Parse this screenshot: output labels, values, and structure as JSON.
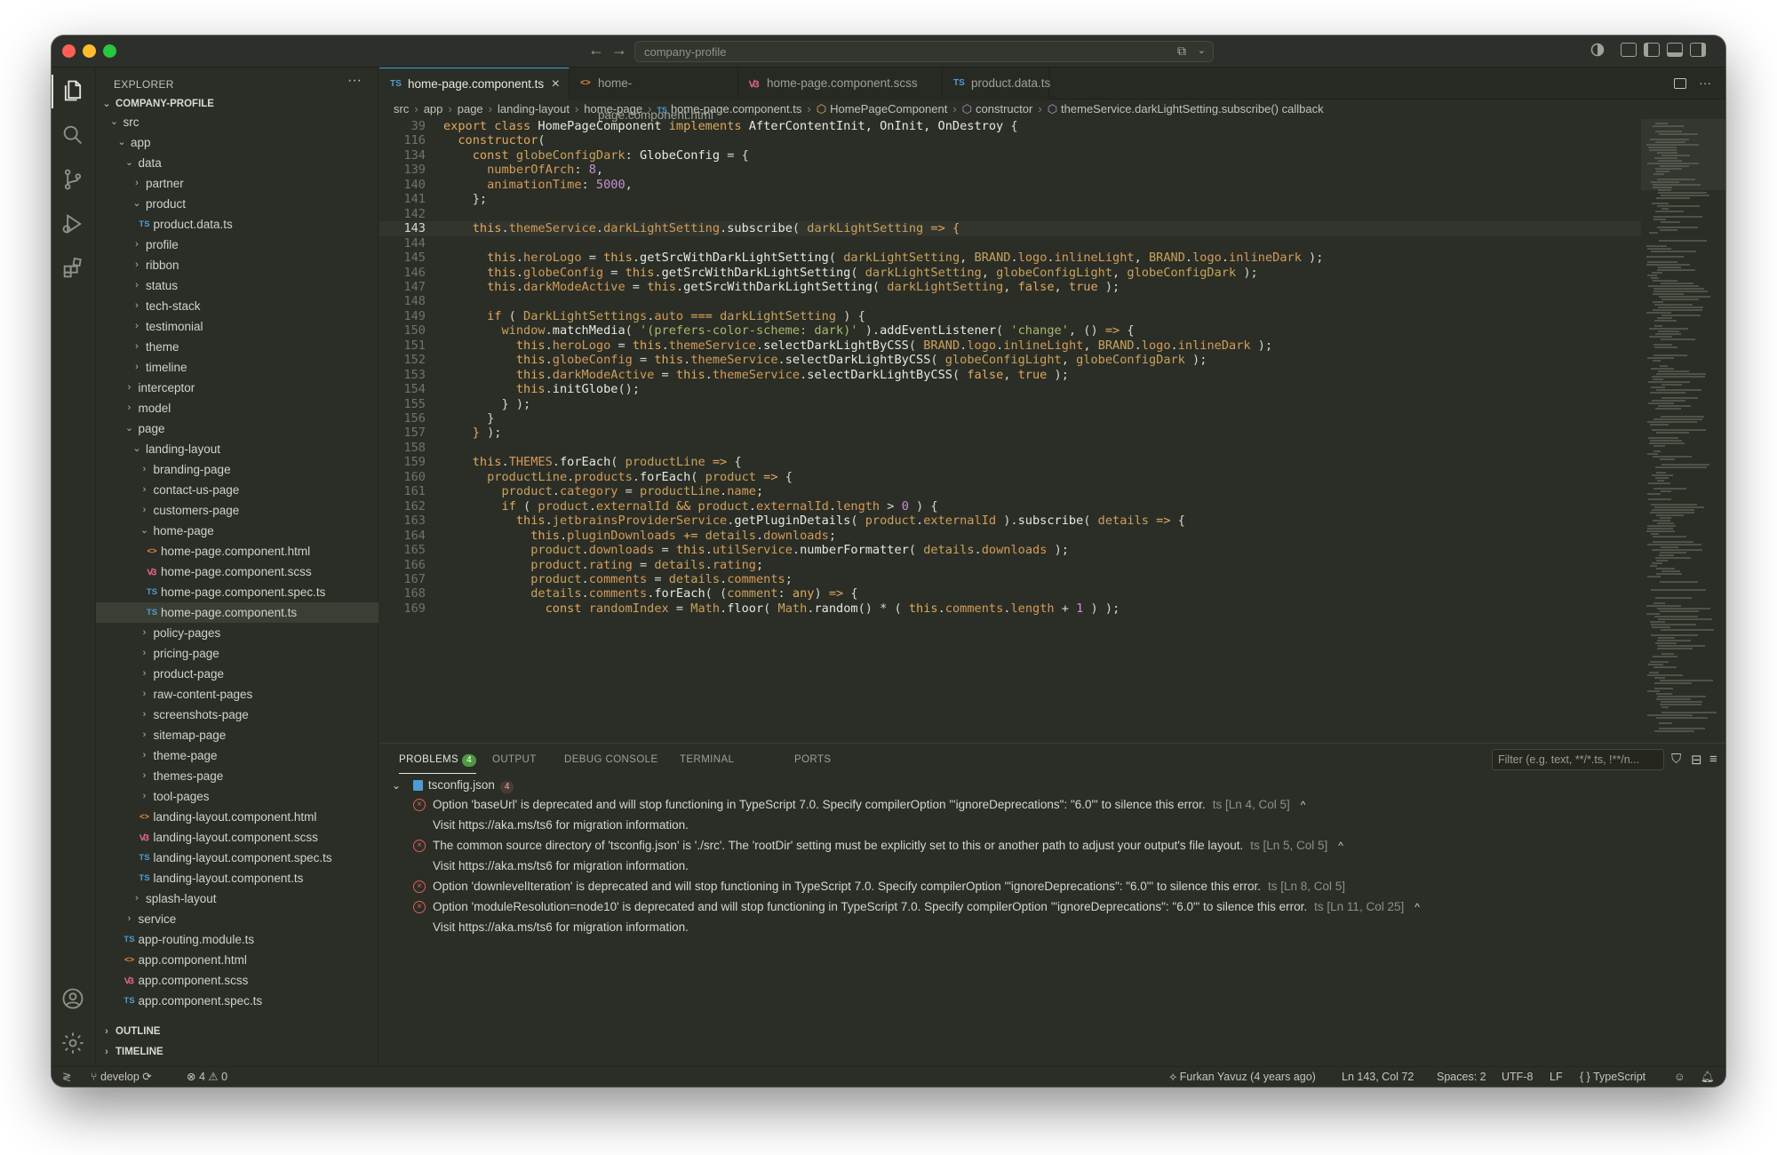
{
  "titlebar": {
    "search_text": "company-profile"
  },
  "sidebar": {
    "title": "EXPLORER",
    "more": "···",
    "root": "COMPANY-PROFILE",
    "outline": "OUTLINE",
    "timeline": "TIMELINE"
  },
  "tree": [
    {
      "label": "src",
      "depth": 1,
      "chev": "open"
    },
    {
      "label": "app",
      "depth": 2,
      "chev": "open"
    },
    {
      "label": "data",
      "depth": 3,
      "chev": "open"
    },
    {
      "label": "partner",
      "depth": 4,
      "chev": "closed"
    },
    {
      "label": "product",
      "depth": 4,
      "chev": "open"
    },
    {
      "label": "product.data.ts",
      "depth": 5,
      "icon": "TS"
    },
    {
      "label": "profile",
      "depth": 4,
      "chev": "closed"
    },
    {
      "label": "ribbon",
      "depth": 4,
      "chev": "closed"
    },
    {
      "label": "status",
      "depth": 4,
      "chev": "closed"
    },
    {
      "label": "tech-stack",
      "depth": 4,
      "chev": "closed"
    },
    {
      "label": "testimonial",
      "depth": 4,
      "chev": "closed"
    },
    {
      "label": "theme",
      "depth": 4,
      "chev": "closed"
    },
    {
      "label": "timeline",
      "depth": 4,
      "chev": "closed"
    },
    {
      "label": "interceptor",
      "depth": 3,
      "chev": "closed"
    },
    {
      "label": "model",
      "depth": 3,
      "chev": "closed"
    },
    {
      "label": "page",
      "depth": 3,
      "chev": "open"
    },
    {
      "label": "landing-layout",
      "depth": 4,
      "chev": "open"
    },
    {
      "label": "branding-page",
      "depth": 5,
      "chev": "closed"
    },
    {
      "label": "contact-us-page",
      "depth": 5,
      "chev": "closed"
    },
    {
      "label": "customers-page",
      "depth": 5,
      "chev": "closed"
    },
    {
      "label": "home-page",
      "depth": 5,
      "chev": "open"
    },
    {
      "label": "home-page.component.html",
      "depth": 6,
      "icon": "<>"
    },
    {
      "label": "home-page.component.scss",
      "depth": 6,
      "icon": "scss"
    },
    {
      "label": "home-page.component.spec.ts",
      "depth": 6,
      "icon": "TS"
    },
    {
      "label": "home-page.component.ts",
      "depth": 6,
      "icon": "TS",
      "selected": true
    },
    {
      "label": "policy-pages",
      "depth": 5,
      "chev": "closed"
    },
    {
      "label": "pricing-page",
      "depth": 5,
      "chev": "closed"
    },
    {
      "label": "product-page",
      "depth": 5,
      "chev": "closed"
    },
    {
      "label": "raw-content-pages",
      "depth": 5,
      "chev": "closed"
    },
    {
      "label": "screenshots-page",
      "depth": 5,
      "chev": "closed"
    },
    {
      "label": "sitemap-page",
      "depth": 5,
      "chev": "closed"
    },
    {
      "label": "theme-page",
      "depth": 5,
      "chev": "closed"
    },
    {
      "label": "themes-page",
      "depth": 5,
      "chev": "closed"
    },
    {
      "label": "tool-pages",
      "depth": 5,
      "chev": "closed"
    },
    {
      "label": "landing-layout.component.html",
      "depth": 5,
      "icon": "<>"
    },
    {
      "label": "landing-layout.component.scss",
      "depth": 5,
      "icon": "scss"
    },
    {
      "label": "landing-layout.component.spec.ts",
      "depth": 5,
      "icon": "TS"
    },
    {
      "label": "landing-layout.component.ts",
      "depth": 5,
      "icon": "TS"
    },
    {
      "label": "splash-layout",
      "depth": 4,
      "chev": "closed"
    },
    {
      "label": "service",
      "depth": 3,
      "chev": "closed"
    },
    {
      "label": "app-routing.module.ts",
      "depth": 3,
      "icon": "TS"
    },
    {
      "label": "app.component.html",
      "depth": 3,
      "icon": "<>"
    },
    {
      "label": "app.component.scss",
      "depth": 3,
      "icon": "scss"
    },
    {
      "label": "app.component.spec.ts",
      "depth": 3,
      "icon": "TS"
    }
  ],
  "tabs": [
    {
      "label": "home-page.component.ts",
      "icon": "TS",
      "active": true,
      "close": "×"
    },
    {
      "label": "home-page.component.html",
      "icon": "<>"
    },
    {
      "label": "home-page.component.scss",
      "icon": "scss"
    },
    {
      "label": "product.data.ts",
      "icon": "TS"
    }
  ],
  "breadcrumb": [
    "src",
    "app",
    "page",
    "landing-layout",
    "home-page",
    "home-page.component.ts",
    "HomePageComponent",
    "constructor",
    "themeService.darkLightSetting.subscribe() callback"
  ],
  "code": [
    {
      "n": "39",
      "html": "<span class='k'>export class</span> <span class='fn'>HomePageComponent</span> <span class='k'>implements</span> <span class='fn'>AfterContentInit, OnInit, OnDestroy</span> {"
    },
    {
      "n": "116",
      "html": "  <span class='k'>constructor</span>("
    },
    {
      "n": "134",
      "html": "    <span class='k'>const</span> <span class='v'>globeConfigDark</span>: <span class='fn'>GlobeConfig</span> = {"
    },
    {
      "n": "139",
      "html": "      <span class='p'>numberOfArch</span>: <span class='n'>8</span>,"
    },
    {
      "n": "140",
      "html": "      <span class='p'>animationTime</span>: <span class='n'>5000</span>,"
    },
    {
      "n": "141",
      "html": "    };"
    },
    {
      "n": "142",
      "html": ""
    },
    {
      "n": "143",
      "html": "    <span class='k'>this</span>.<span class='p'>themeService</span>.<span class='p'>darkLightSetting</span>.<span class='fn'>subscribe</span>( <span class='v'>darkLightSetting</span> <span class='k'>=></span> <span class='br'>{</span>",
      "current": true
    },
    {
      "n": "144",
      "html": ""
    },
    {
      "n": "145",
      "html": "      <span class='k'>this</span>.<span class='p'>heroLogo</span> = <span class='k'>this</span>.<span class='fn'>getSrcWithDarkLightSetting</span>( <span class='v'>darkLightSetting</span>, <span class='v'>BRAND</span>.<span class='p'>logo</span>.<span class='p'>inlineLight</span>, <span class='v'>BRAND</span>.<span class='p'>logo</span>.<span class='p'>inlineDark</span> );"
    },
    {
      "n": "146",
      "html": "      <span class='k'>this</span>.<span class='p'>globeConfig</span> = <span class='k'>this</span>.<span class='fn'>getSrcWithDarkLightSetting</span>( <span class='v'>darkLightSetting</span>, <span class='v'>globeConfigLight</span>, <span class='v'>globeConfigDark</span> );"
    },
    {
      "n": "147",
      "html": "      <span class='k'>this</span>.<span class='p'>darkModeActive</span> = <span class='k'>this</span>.<span class='fn'>getSrcWithDarkLightSetting</span>( <span class='v'>darkLightSetting</span>, <span class='k'>false</span>, <span class='k'>true</span> );"
    },
    {
      "n": "148",
      "html": ""
    },
    {
      "n": "149",
      "html": "      <span class='k'>if</span> ( <span class='v'>DarkLightSettings</span>.<span class='p'>auto</span> <span class='k'>===</span> <span class='v'>darkLightSetting</span> ) {"
    },
    {
      "n": "150",
      "html": "        <span class='v'>window</span>.<span class='fn'>matchMedia</span>( <span class='s'>'(prefers-color-scheme: dark)'</span> ).<span class='fn'>addEventListener</span>( <span class='s'>'change'</span>, () <span class='k'>=></span> {"
    },
    {
      "n": "151",
      "html": "          <span class='k'>this</span>.<span class='p'>heroLogo</span> = <span class='k'>this</span>.<span class='p'>themeService</span>.<span class='fn'>selectDarkLightByCSS</span>( <span class='v'>BRAND</span>.<span class='p'>logo</span>.<span class='p'>inlineLight</span>, <span class='v'>BRAND</span>.<span class='p'>logo</span>.<span class='p'>inlineDark</span> );"
    },
    {
      "n": "152",
      "html": "          <span class='k'>this</span>.<span class='p'>globeConfig</span> = <span class='k'>this</span>.<span class='p'>themeService</span>.<span class='fn'>selectDarkLightByCSS</span>( <span class='v'>globeConfigLight</span>, <span class='v'>globeConfigDark</span> );"
    },
    {
      "n": "153",
      "html": "          <span class='k'>this</span>.<span class='p'>darkModeActive</span> = <span class='k'>this</span>.<span class='p'>themeService</span>.<span class='fn'>selectDarkLightByCSS</span>( <span class='k'>false</span>, <span class='k'>true</span> );"
    },
    {
      "n": "154",
      "html": "          <span class='k'>this</span>.<span class='fn'>initGlobe</span>();"
    },
    {
      "n": "155",
      "html": "        } );"
    },
    {
      "n": "156",
      "html": "      }"
    },
    {
      "n": "157",
      "html": "    <span class='br'>}</span> );"
    },
    {
      "n": "158",
      "html": ""
    },
    {
      "n": "159",
      "html": "    <span class='k'>this</span>.<span class='p'>THEMES</span>.<span class='fn'>forEach</span>( <span class='v'>productLine</span> <span class='k'>=></span> {"
    },
    {
      "n": "160",
      "html": "      <span class='v'>productLine</span>.<span class='p'>products</span>.<span class='fn'>forEach</span>( <span class='v'>product</span> <span class='k'>=></span> {"
    },
    {
      "n": "161",
      "html": "        <span class='v'>product</span>.<span class='p'>category</span> = <span class='v'>productLine</span>.<span class='p'>name</span>;"
    },
    {
      "n": "162",
      "html": "        <span class='k'>if</span> ( <span class='v'>product</span>.<span class='p'>externalId</span> <span class='k'>&amp;&amp;</span> <span class='v'>product</span>.<span class='p'>externalId</span>.<span class='p'>length</span> &gt; <span class='n'>0</span> ) {"
    },
    {
      "n": "163",
      "html": "          <span class='k'>this</span>.<span class='p'>jetbrainsProviderService</span>.<span class='fn'>getPluginDetails</span>( <span class='v'>product</span>.<span class='p'>externalId</span> ).<span class='fn'>subscribe</span>( <span class='v'>details</span> <span class='k'>=></span> {"
    },
    {
      "n": "164",
      "html": "            <span class='k'>this</span>.<span class='p'>pluginDownloads</span> <span class='k'>+=</span> <span class='v'>details</span>.<span class='p'>downloads</span>;"
    },
    {
      "n": "165",
      "html": "            <span class='v'>product</span>.<span class='p'>downloads</span> = <span class='k'>this</span>.<span class='p'>utilService</span>.<span class='fn'>numberFormatter</span>( <span class='v'>details</span>.<span class='p'>downloads</span> );"
    },
    {
      "n": "166",
      "html": "            <span class='v'>product</span>.<span class='p'>rating</span> = <span class='v'>details</span>.<span class='p'>rating</span>;"
    },
    {
      "n": "167",
      "html": "            <span class='v'>product</span>.<span class='p'>comments</span> = <span class='v'>details</span>.<span class='p'>comments</span>;"
    },
    {
      "n": "168",
      "html": "            <span class='v'>details</span>.<span class='p'>comments</span>.<span class='fn'>forEach</span>( (<span class='v'>comment</span>: <span class='k'>any</span>) <span class='k'>=></span> {"
    },
    {
      "n": "169",
      "html": "              <span class='k'>const</span> <span class='v'>randomIndex</span> = <span class='v'>Math</span>.<span class='fn'>floor</span>( <span class='v'>Math</span>.<span class='fn'>random</span>() * ( <span class='k'>this</span>.<span class='p'>comments</span>.<span class='p'>length</span> + <span class='n'>1</span> ) );"
    }
  ],
  "panel": {
    "tabs": [
      "PROBLEMS",
      "OUTPUT",
      "DEBUG CONSOLE",
      "TERMINAL",
      "PORTS"
    ],
    "problems_count": "4",
    "filter_placeholder": "Filter (e.g. text, **/*.ts, !**/n...",
    "file": "tsconfig.json",
    "file_count": "4",
    "problems": [
      {
        "text": "Option 'baseUrl' is deprecated and will stop functioning in TypeScript 7.0. Specify compilerOption '\"ignoreDeprecations\": \"6.0\"' to silence this error.",
        "src": "ts",
        "loc": "[Ln 4, Col 5]",
        "caret": "^",
        "sub": "Visit https://aka.ms/ts6 for migration information."
      },
      {
        "text": "The common source directory of 'tsconfig.json' is './src'. The 'rootDir' setting must be explicitly set to this or another path to adjust your output's file layout.",
        "src": "ts",
        "loc": "[Ln 5, Col 5]",
        "caret": "^",
        "sub": "Visit https://aka.ms/ts6 for migration information."
      },
      {
        "text": "Option 'downlevelIteration' is deprecated and will stop functioning in TypeScript 7.0. Specify compilerOption '\"ignoreDeprecations\": \"6.0\"' to silence this error.",
        "src": "ts",
        "loc": "[Ln 8, Col 5]",
        "caret": "",
        "sub": ""
      },
      {
        "text": "Option 'moduleResolution=node10' is deprecated and will stop functioning in TypeScript 7.0. Specify compilerOption '\"ignoreDeprecations\": \"6.0\"' to silence this error.",
        "src": "ts",
        "loc": "[Ln 11, Col 25]",
        "caret": "^",
        "sub": "Visit https://aka.ms/ts6 for migration information."
      }
    ]
  },
  "statusbar": {
    "branch": "develop",
    "errors": "4",
    "warnings": "0",
    "blame": "Furkan Yavuz (4 years ago)",
    "position": "Ln 143, Col 72",
    "spaces": "Spaces: 2",
    "encoding": "UTF-8",
    "eol": "LF",
    "language": "TypeScript"
  }
}
